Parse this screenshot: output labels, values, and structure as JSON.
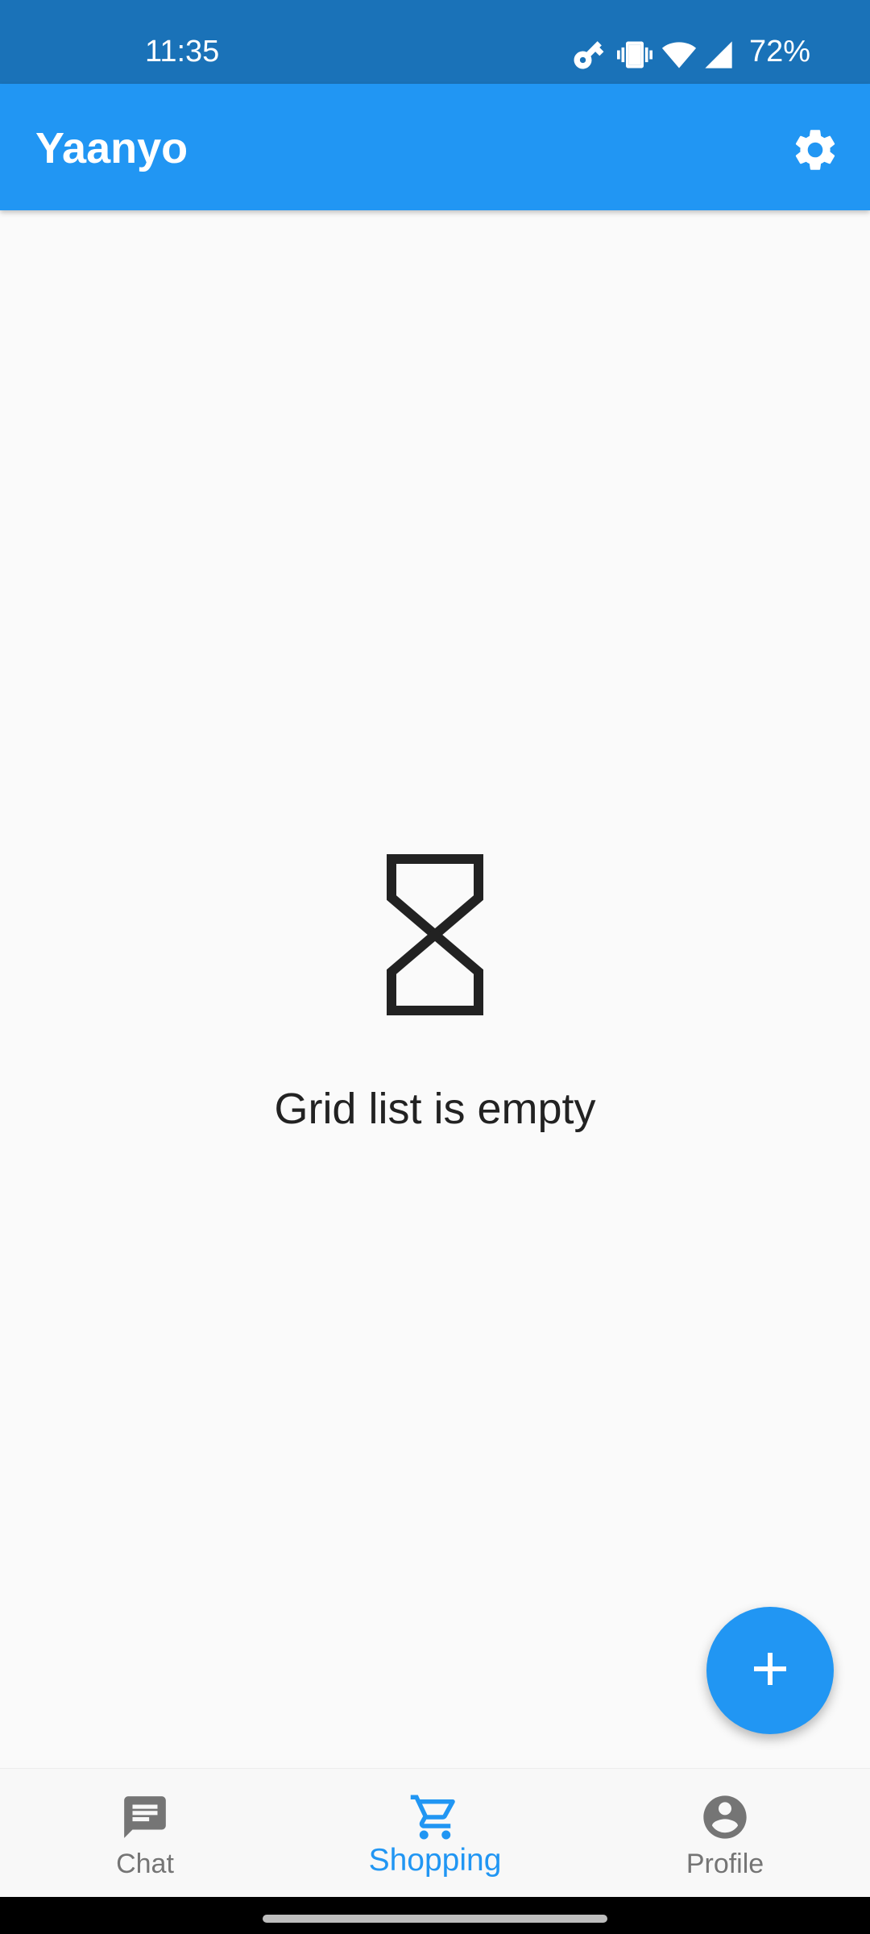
{
  "status_bar": {
    "time": "11:35",
    "battery": "72%",
    "icons": [
      "key-icon",
      "vibrate-icon",
      "wifi-icon",
      "signal-icon"
    ]
  },
  "app_bar": {
    "title": "Yaanyo",
    "settings_icon": "gear-icon"
  },
  "empty_state": {
    "icon": "hourglass-icon",
    "message": "Grid list is empty"
  },
  "fab": {
    "icon": "plus-icon"
  },
  "bottom_nav": {
    "items": [
      {
        "label": "Chat",
        "icon": "chat-icon",
        "active": false
      },
      {
        "label": "Shopping",
        "icon": "cart-icon",
        "active": true
      },
      {
        "label": "Profile",
        "icon": "account-icon",
        "active": false
      }
    ]
  },
  "colors": {
    "primary": "#2196f3",
    "status_bar": "#1a72b8",
    "background": "#fafafa",
    "nav_inactive": "#757575"
  }
}
